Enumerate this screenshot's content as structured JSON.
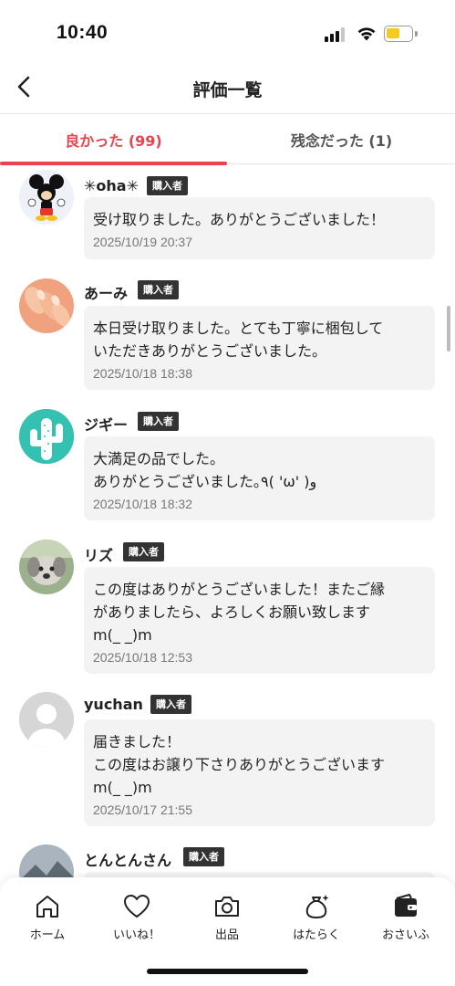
{
  "status_bar": {
    "time": "10:40"
  },
  "header": {
    "title": "評価一覧"
  },
  "tabs": [
    {
      "label": "良かった (99)"
    },
    {
      "label": "残念だった (1)"
    }
  ],
  "reviews": [
    {
      "name": "✳︎oha✳︎",
      "badge": "購入者",
      "comment": "受け取りました。ありがとうございました！",
      "date": "2025/10/19 20:37"
    },
    {
      "name": "あーみ",
      "badge": "購入者",
      "comment": "本日受け取りました。とても丁寧に梱包して\nいただきありがとうございました。",
      "date": "2025/10/18 18:38"
    },
    {
      "name": "ジギー",
      "badge": "購入者",
      "comment": "大満足の品でした。\nありがとうございました｡٩( 'ω' )و",
      "date": "2025/10/18 18:32"
    },
    {
      "name": "リズ",
      "badge": "購入者",
      "comment": "この度はありがとうございました！またご縁\nがありましたら、よろしくお願い致します\nm(_ _)m",
      "date": "2025/10/18 12:53"
    },
    {
      "name": "yuchan",
      "badge": "購入者",
      "comment": "届きました！\nこの度はお譲り下さりありがとうございます\nm(_ _)m",
      "date": "2025/10/17 21:55"
    },
    {
      "name": "とんとんさん",
      "badge": "購入者",
      "comment": "",
      "date": ""
    }
  ],
  "bottom_nav": [
    {
      "label": "ホーム",
      "icon": "home-icon"
    },
    {
      "label": "いいね！",
      "icon": "heart-icon"
    },
    {
      "label": "出品",
      "icon": "camera-icon"
    },
    {
      "label": "はたらく",
      "icon": "money-bag-icon"
    },
    {
      "label": "おさいふ",
      "icon": "wallet-icon"
    }
  ],
  "colors": {
    "accent": "#e8434e",
    "badge_bg": "#333333",
    "bubble_bg": "#f3f3f3",
    "battery": "#f5cb1f"
  }
}
